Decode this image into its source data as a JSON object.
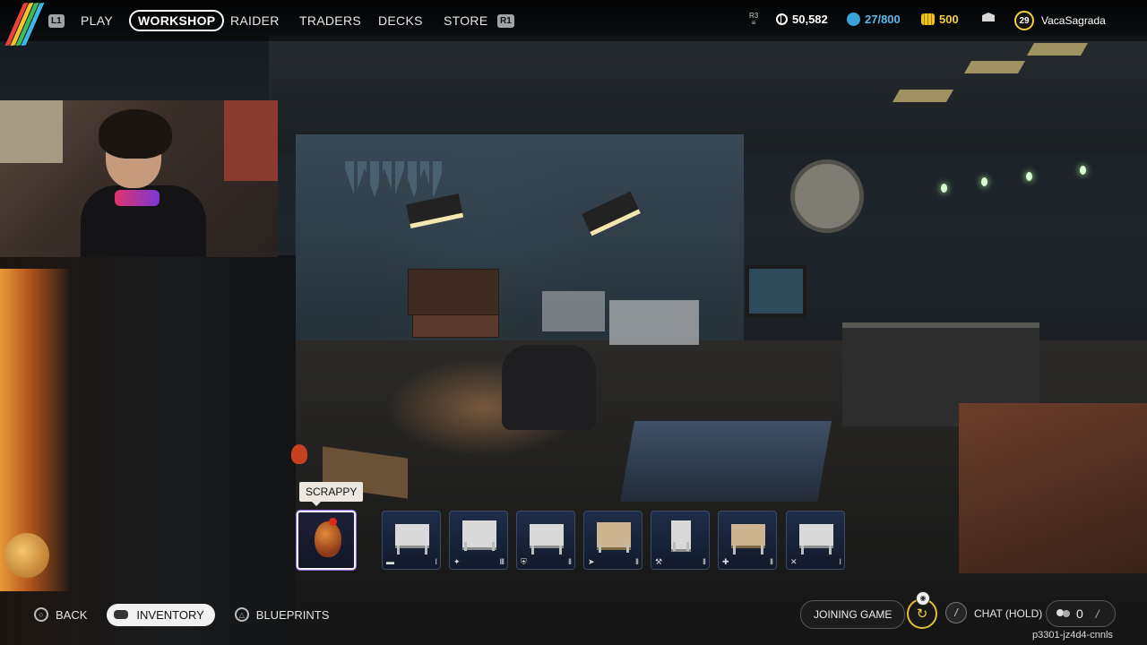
{
  "topbar": {
    "logo": "arc-raiders-logo",
    "left_bumper": "L1",
    "right_bumper": "R1",
    "nav": [
      "PLAY",
      "WORKSHOP",
      "RAIDER",
      "TRADERS",
      "DECKS",
      "STORE"
    ],
    "active_nav": "WORKSHOP",
    "r3_hint": "R3",
    "coins": "50,582",
    "blue_currency": "27/800",
    "gold_currency": "500",
    "level": "29",
    "username": "VacaSagrada"
  },
  "workshop": {
    "selected_tooltip": "SCRAPPY",
    "slots": [
      {
        "name": "Scrappy",
        "icon": "rooster",
        "corner": "",
        "tier": ""
      },
      {
        "name": "workbench",
        "icon": "workbench",
        "corner": "▬",
        "tier": "I"
      },
      {
        "name": "workbench",
        "icon": "workbench",
        "corner": "✦",
        "tier": "III"
      },
      {
        "name": "workbench",
        "icon": "workbench",
        "corner": "⛨",
        "tier": "II"
      },
      {
        "name": "workbench",
        "icon": "workbench",
        "corner": "➤",
        "tier": "II"
      },
      {
        "name": "workbench",
        "icon": "workbench",
        "corner": "⚒",
        "tier": "II"
      },
      {
        "name": "workbench",
        "icon": "workbench",
        "corner": "✚",
        "tier": "II"
      },
      {
        "name": "workbench",
        "icon": "workbench",
        "corner": "✕",
        "tier": "I"
      }
    ]
  },
  "bottombar": {
    "back": "BACK",
    "inventory": "INVENTORY",
    "blueprints": "BLUEPRINTS",
    "joining_game": "JOINING GAME",
    "chat": "CHAT (HOLD)",
    "party_count": "0",
    "session_id": "p3301-jz4d4-cnnls"
  },
  "colors": {
    "accent_gold": "#f2d23b",
    "accent_blue": "#3aa3d8",
    "slot_bg": "#1f2d4a"
  }
}
